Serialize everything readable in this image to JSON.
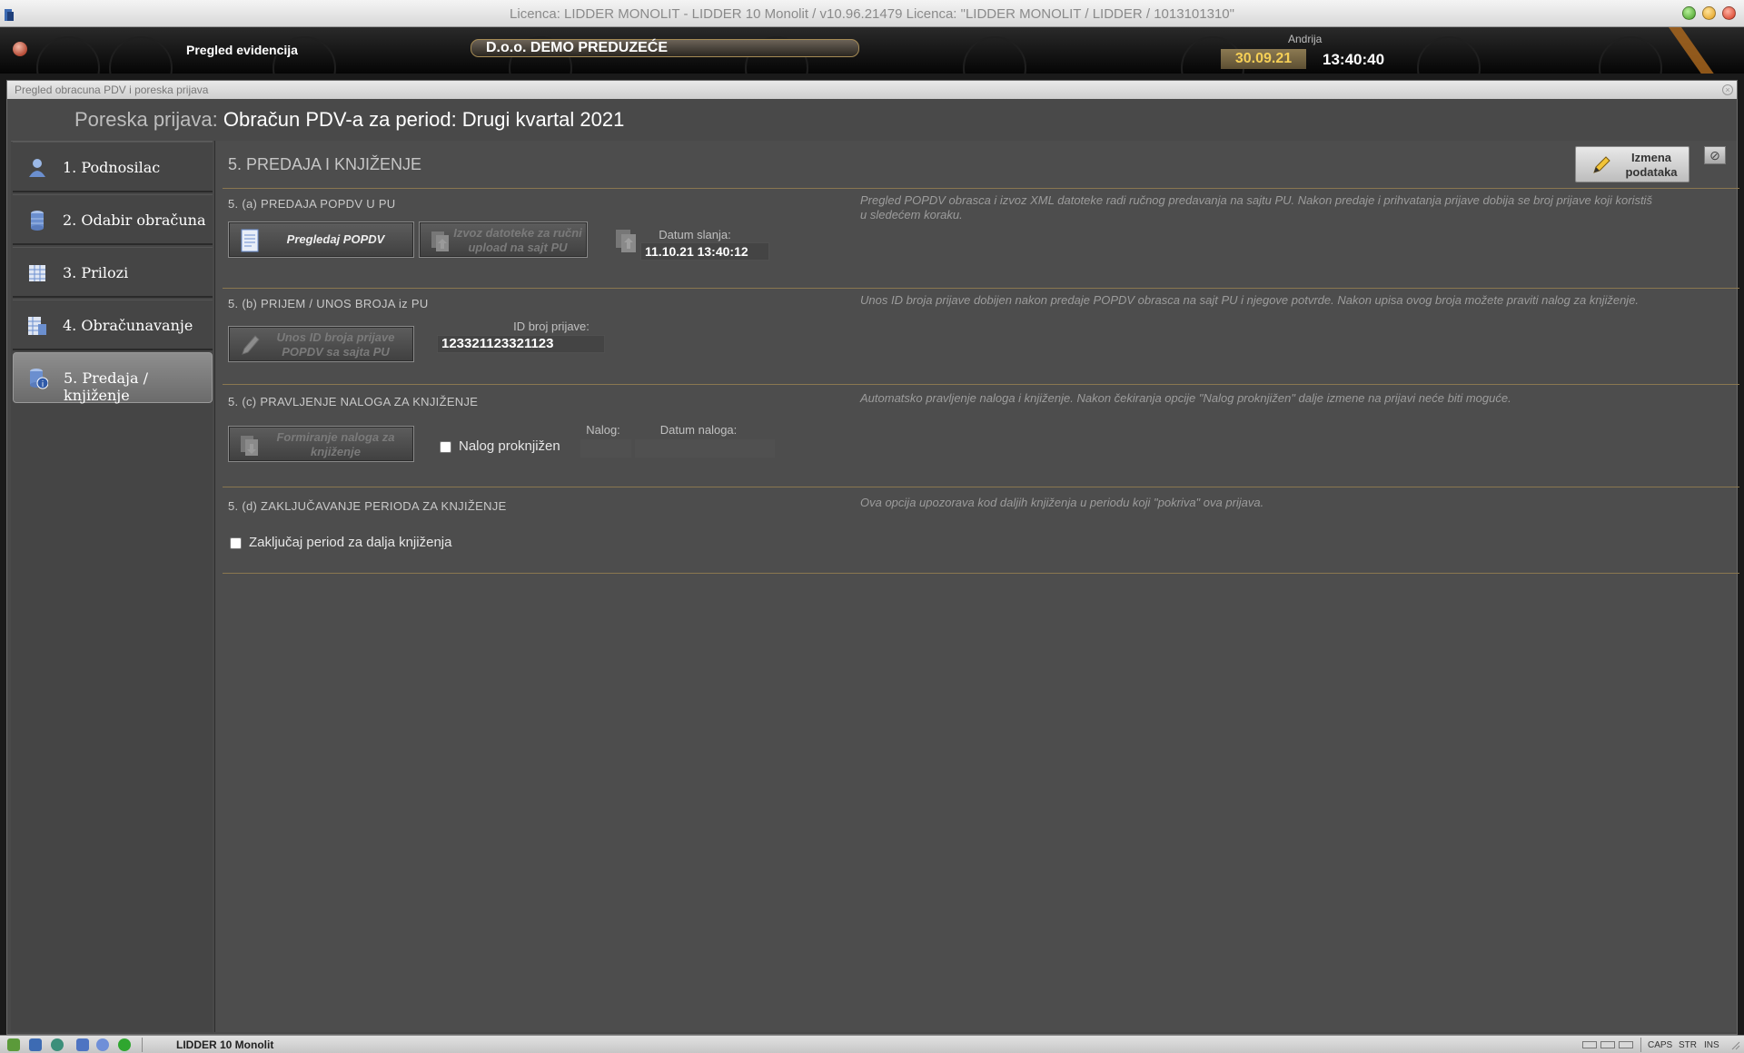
{
  "window": {
    "title": "Licenca: LIDDER MONOLIT - LIDDER 10 Monolit / v10.96.21479 Licenca: \"LIDDER MONOLIT / LIDDER / 1013101310\""
  },
  "header": {
    "module": "Pregled evidencija",
    "company": "D.o.o. DEMO PREDUZEĆE",
    "user": "Andrija",
    "date": "30.09.21",
    "time": "13:40:40"
  },
  "main_window": {
    "caption": "Pregled obracuna PDV i poreska prijava",
    "title_label": "Poreska prijava:",
    "title_value": "Obračun PDV-a za period: Drugi kvartal 2021"
  },
  "sidebar": {
    "items": [
      {
        "label": "1. Podnosilac",
        "icon": "person-icon"
      },
      {
        "label": "2. Odabir obračuna",
        "icon": "database-icon"
      },
      {
        "label": "3. Prilozi",
        "icon": "grid-icon"
      },
      {
        "label": "4. Obračunavanje",
        "icon": "calculator-icon"
      },
      {
        "label": "5. Predaja / knjiženje",
        "icon": "database-info-icon",
        "active": true
      }
    ]
  },
  "content": {
    "heading": "5. PREDAJA I KNJIŽENJE",
    "edit_button": "Izmena podataka",
    "section_a": {
      "title": "5. (a) PREDAJA POPDV U PU",
      "note": "Pregled POPDV obrasca i izvoz XML datoteke radi ručnog predavanja na sajtu PU. Nakon predaje i prihvatanja prijave dobija se broj prijave koji koristiš u sledećem koraku.",
      "btn_view": "Pregledaj POPDV",
      "btn_export": "Izvoz datoteke za ručni upload na sajt PU",
      "send_date_label": "Datum slanja:",
      "send_date_value": "11.10.21 13:40:12"
    },
    "section_b": {
      "title": "5. (b) PRIJEM / UNOS BROJA iz PU",
      "note": "Unos ID broja prijave dobijen nakon predaje POPDV obrasca na sajt PU i njegove potvrde. Nakon upisa ovog broja možete praviti nalog za knjiženje.",
      "btn_enter_id": "Unos ID broja prijave POPDV sa sajta PU",
      "id_label": "ID broj prijave:",
      "id_value": "123321123321123"
    },
    "section_c": {
      "title": "5. (c) PRAVLJENJE NALOGA ZA KNJIŽENJE",
      "note": "Automatsko pravljenje naloga i knjiženje. Nakon čekiranja opcije \"Nalog proknjižen\" dalje izmene na prijavi neće biti moguće.",
      "btn_create": "Formiranje naloga za knjiženje",
      "chk_posted": "Nalog proknjižen",
      "nalog_label": "Nalog:",
      "nalog_value": "",
      "nalog_date_label": "Datum naloga:",
      "nalog_date_value": ""
    },
    "section_d": {
      "title": "5. (d) ZAKLJUČAVANJE PERIODA ZA KNJIŽENJE",
      "note": "Ova opcija upozorava kod daljih knjiženja u periodu koji \"pokriva\" ova prijava.",
      "chk_lock": "Zaključaj period za dalja knjiženja"
    }
  },
  "statusbar": {
    "app": "LIDDER 10 Monolit",
    "caps": "CAPS",
    "str": "STR",
    "ins": "INS"
  },
  "colors": {
    "accent_gold": "#8a7750",
    "panel_bg": "#4d4d4d",
    "date_text": "#f5cf56"
  }
}
